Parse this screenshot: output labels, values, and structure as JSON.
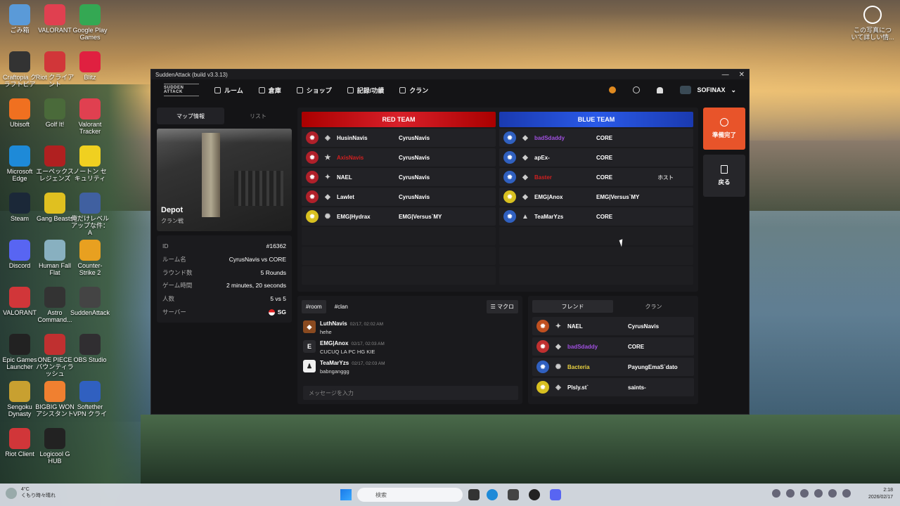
{
  "desktop": {
    "icons": [
      {
        "label": "ごみ箱",
        "icon": "recycle-bin-icon",
        "color": "#5a9ad8"
      },
      {
        "label": "VALORANT",
        "icon": "valorant-icon",
        "color": "#e04050"
      },
      {
        "label": "Google Play Games",
        "icon": "google-play-games-icon",
        "color": "#34a853"
      },
      {
        "label": "Craftopia クラフトピア",
        "icon": "craftopia-icon",
        "color": "#333"
      },
      {
        "label": "Riot クライアント",
        "icon": "riot-client-icon",
        "color": "#d13639"
      },
      {
        "label": "Blitz",
        "icon": "blitz-icon",
        "color": "#e02040"
      },
      {
        "label": "Ubisoft",
        "icon": "ubisoft-icon",
        "color": "#f07020"
      },
      {
        "label": "Golf It!",
        "icon": "golf-it-icon",
        "color": "#4a6a3a"
      },
      {
        "label": "Valorant Tracker",
        "icon": "valorant-tracker-icon",
        "color": "#e04050"
      },
      {
        "label": "Microsoft Edge",
        "icon": "edge-icon",
        "color": "#1e8ad8"
      },
      {
        "label": "エーペックスレジェンズ",
        "icon": "apex-icon",
        "color": "#b02020"
      },
      {
        "label": "ノートン セキュリティ",
        "icon": "norton-icon",
        "color": "#f0d020"
      },
      {
        "label": "Steam",
        "icon": "steam-icon",
        "color": "#1b2838"
      },
      {
        "label": "Gang Beasts",
        "icon": "gang-beasts-icon",
        "color": "#e0c020"
      },
      {
        "label": "俺だけレベルアップな件：A",
        "icon": "solo-leveling-icon",
        "color": "#4060a0"
      },
      {
        "label": "Discord",
        "icon": "discord-icon",
        "color": "#5865f2"
      },
      {
        "label": "Human Fall Flat",
        "icon": "human-fall-flat-icon",
        "color": "#88b0c0"
      },
      {
        "label": "Counter-Strike 2",
        "icon": "counter-strike-icon",
        "color": "#e8a020"
      },
      {
        "label": "VALORANT",
        "icon": "valorant-icon",
        "color": "#d13639"
      },
      {
        "label": "Astro Command...",
        "icon": "astro-icon",
        "color": "#333"
      },
      {
        "label": "SuddenAttack",
        "icon": "sudden-attack-icon",
        "color": "#444"
      },
      {
        "label": "Epic Games Launcher",
        "icon": "epic-games-icon",
        "color": "#222"
      },
      {
        "label": "ONE PIECE バウンティラッシュ",
        "icon": "one-piece-icon",
        "color": "#c03030"
      },
      {
        "label": "OBS Studio",
        "icon": "obs-icon",
        "color": "#302e31"
      },
      {
        "label": "Sengoku Dynasty",
        "icon": "sengoku-icon",
        "color": "#c8a030"
      },
      {
        "label": "BIGBIG WON アシスタント",
        "icon": "bigbig-won-icon",
        "color": "#f08030"
      },
      {
        "label": "Softether VPN クライ",
        "icon": "softether-icon",
        "color": "#3060c0"
      },
      {
        "label": "Riot Client",
        "icon": "riot-client-icon",
        "color": "#d13639"
      },
      {
        "label": "Logicool G HUB",
        "icon": "logicool-ghub-icon",
        "color": "#222"
      }
    ],
    "photo_info_label": "この写真について詳しい情..."
  },
  "window": {
    "title": "SuddenAttack (build v3.3.13)",
    "logo": "SUDDEN ATTACK",
    "nav": {
      "room": "ルーム",
      "storage": "倉庫",
      "shop": "ショップ",
      "records": "記録/功績",
      "clan": "クラン",
      "username": "SOFINAX"
    },
    "left": {
      "tab_map": "マップ情報",
      "tab_list": "リスト",
      "map_name": "Depot",
      "map_type": "クラン戦",
      "info": [
        {
          "k": "ID",
          "v": "#16362"
        },
        {
          "k": "ルーム名",
          "v": "CyrusNavis vs CORE"
        },
        {
          "k": "ラウンド数",
          "v": "5 Rounds"
        },
        {
          "k": "ゲーム時間",
          "v": "2 minutes, 20 seconds"
        },
        {
          "k": "人数",
          "v": "5 vs 5"
        },
        {
          "k": "サーバー",
          "v": "SG"
        }
      ]
    },
    "teams": {
      "red_label": "RED TEAM",
      "blue_label": "BLUE TEAM",
      "red": [
        {
          "name": "HusinNavis",
          "clan": "CyrusNavis",
          "name_color": "#ffffff",
          "emblem_color": "#b0202a",
          "rank": "◈"
        },
        {
          "name": "AxisNavis",
          "clan": "CyrusNavis",
          "name_color": "#d02020",
          "emblem_color": "#b0202a",
          "rank": "★"
        },
        {
          "name": "NAEL",
          "clan": "CyrusNavis",
          "name_color": "#ffffff",
          "emblem_color": "#b0202a",
          "rank": "✦"
        },
        {
          "name": "Lawlet",
          "clan": "CyrusNavis",
          "name_color": "#ffffff",
          "emblem_color": "#b0202a",
          "rank": "◆"
        },
        {
          "name": "EMG|Hydrax",
          "clan": "EMG|Versus`MY",
          "name_color": "#ffffff",
          "emblem_color": "#d8c020",
          "rank": "✺"
        }
      ],
      "blue": [
        {
          "name": "badSdaddy",
          "clan": "CORE",
          "name_color": "#a050e0",
          "emblem_color": "#3060c0",
          "rank": "◆",
          "tag": ""
        },
        {
          "name": "apEx-",
          "clan": "CORE",
          "name_color": "#ffffff",
          "emblem_color": "#3060c0",
          "rank": "◆",
          "tag": ""
        },
        {
          "name": "Baster",
          "clan": "CORE",
          "name_color": "#d02020",
          "emblem_color": "#3060c0",
          "rank": "◆",
          "tag": "ホスト"
        },
        {
          "name": "EMG|Anox",
          "clan": "EMG|Versus`MY",
          "name_color": "#ffffff",
          "emblem_color": "#d8c020",
          "rank": "◆",
          "tag": ""
        },
        {
          "name": "TeaMarYzs",
          "clan": "CORE",
          "name_color": "#ffffff",
          "emblem_color": "#3060c0",
          "rank": "▲",
          "tag": ""
        }
      ]
    },
    "actions": {
      "ready": "準備完了",
      "back": "戻る"
    },
    "chat": {
      "tab_room": "#room",
      "tab_clan": "#clan",
      "macro": "マクロ",
      "placeholder": "メッセージを入力",
      "messages": [
        {
          "who": "LuthNavis",
          "when": "02/17, 02:02 AM",
          "text": "hehe",
          "avatar": "◆",
          "avatar_color": "#8a4a20"
        },
        {
          "who": "EMG|Anox",
          "when": "02/17, 02:03 AM",
          "text": "CUCUQ LA PC HG KIE",
          "avatar": "E",
          "avatar_color": "#2a2a2e"
        },
        {
          "who": "TeaMarYzs",
          "when": "02/17, 02:03 AM",
          "text": "babnganggg",
          "avatar": "♟",
          "avatar_color": "#f0f0f0"
        }
      ]
    },
    "friends": {
      "tab_friend": "フレンド",
      "tab_clan": "クラン",
      "list": [
        {
          "name": "NAEL",
          "clan": "CyrusNavis",
          "name_color": "#ffffff",
          "emblem_color": "#c05020",
          "rank": "✦"
        },
        {
          "name": "badSdaddy",
          "clan": "CORE",
          "name_color": "#a050e0",
          "emblem_color": "#c03030",
          "rank": "◆"
        },
        {
          "name": "Bacteria",
          "clan": "PayungEmaS`dato",
          "name_color": "#e8d040",
          "emblem_color": "#3060c0",
          "rank": "✺"
        },
        {
          "name": "Plsly.st`",
          "clan": "saints-",
          "name_color": "#ffffff",
          "emblem_color": "#d8c020",
          "rank": "◈"
        }
      ]
    }
  },
  "taskbar": {
    "temp": "4°C",
    "weather": "くもり時々晴れ",
    "search": "検索",
    "time": "2:18",
    "date": "2026/02/17"
  }
}
